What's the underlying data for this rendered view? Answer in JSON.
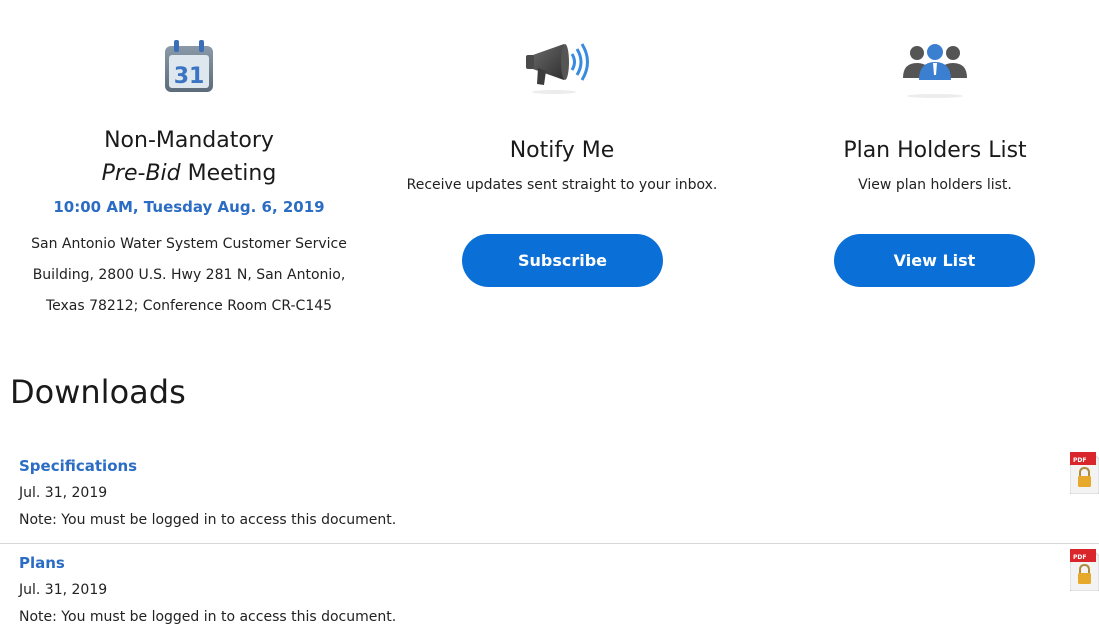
{
  "meeting": {
    "icon": "calendar-icon",
    "calendar_day": "31",
    "title_line1": "Non-Mandatory",
    "title_italic": "Pre-Bid",
    "title_rest": " Meeting",
    "time": "10:00 AM, Tuesday Aug. 6, 2019",
    "address": "San Antonio Water System Customer Service Building, 2800 U.S. Hwy 281 N, San Antonio, Texas 78212; Conference Room CR-C145"
  },
  "notify": {
    "icon": "megaphone-icon",
    "title": "Notify Me",
    "description": "Receive updates sent straight to your inbox.",
    "button_label": "Subscribe"
  },
  "plan_holders": {
    "icon": "people-icon",
    "title": "Plan Holders List",
    "description": "View plan holders list.",
    "button_label": "View List"
  },
  "downloads": {
    "heading": "Downloads",
    "items": [
      {
        "name": "Specifications",
        "date": "Jul. 31, 2019",
        "note": "Note: You must be logged in to access this document.",
        "icon": "locked-pdf-icon",
        "icon_label": "PDF"
      },
      {
        "name": "Plans",
        "date": "Jul. 31, 2019",
        "note": "Note: You must be logged in to access this document.",
        "icon": "locked-pdf-icon",
        "icon_label": "PDF"
      }
    ]
  },
  "colors": {
    "accent": "#0a6fd6",
    "link": "#2b6cc4",
    "pdf_red": "#d9262a",
    "lock_gold": "#e6a92b"
  }
}
